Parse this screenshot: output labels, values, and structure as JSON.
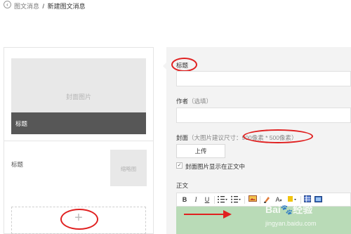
{
  "header": {
    "back_icon": "chevron-left-icon",
    "breadcrumb_prev": "图文消息",
    "breadcrumb_sep": "/",
    "breadcrumb_current": "新建图文消息"
  },
  "preview": {
    "cover_placeholder": "封面图片",
    "cover_title": "标题",
    "item_title": "标题",
    "thumb_placeholder": "缩略图",
    "add_symbol": "+"
  },
  "form": {
    "title_label": "标题",
    "author_label": "作者",
    "author_hint": "（选填）",
    "cover_label": "封面",
    "cover_hint_prefix": "（大图片建议尺寸：",
    "cover_hint_size": "900像素 * 500像素",
    "cover_hint_suffix": "）",
    "upload_button": "上传",
    "show_cover_checked": true,
    "show_cover_label": "封面图片显示在正文中",
    "body_label": "正文"
  },
  "toolbar": {
    "bold": "B",
    "italic": "I",
    "underline": "U",
    "font_color": "A"
  },
  "watermark": {
    "text": "Bai",
    "text2": "经验",
    "sub": "jingyan.baidu.com"
  },
  "colors": {
    "annotation": "#e02020",
    "editor_bg": "#b9dbb7",
    "cover_bar": "#575757"
  }
}
